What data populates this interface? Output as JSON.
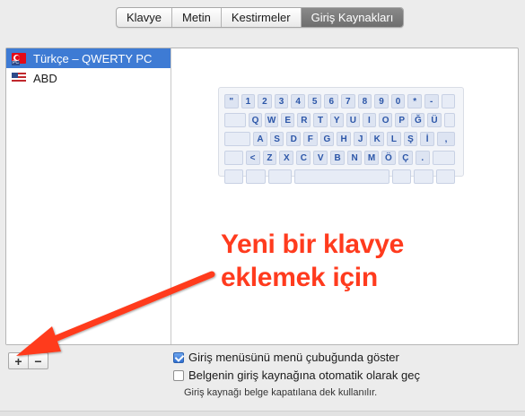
{
  "tabs": [
    {
      "label": "Klavye",
      "active": false
    },
    {
      "label": "Metin",
      "active": false
    },
    {
      "label": "Kestirmeler",
      "active": false
    },
    {
      "label": "Giriş Kaynakları",
      "active": true
    }
  ],
  "sources": [
    {
      "label": "Türkçe – QWERTY PC",
      "icon": "turkish-flag-icon",
      "selected": true
    },
    {
      "label": "ABD",
      "icon": "us-flag-icon",
      "selected": false
    }
  ],
  "keyboard": {
    "rows": [
      [
        "\"",
        "1",
        "2",
        "3",
        "4",
        "5",
        "6",
        "7",
        "8",
        "9",
        "0",
        "*",
        "-",
        ""
      ],
      [
        "",
        "Q",
        "W",
        "E",
        "R",
        "T",
        "Y",
        "U",
        "I",
        "O",
        "P",
        "Ğ",
        "Ü",
        ""
      ],
      [
        "",
        "A",
        "S",
        "D",
        "F",
        "G",
        "H",
        "J",
        "K",
        "L",
        "Ş",
        "İ",
        ","
      ],
      [
        "",
        "<",
        "Z",
        "X",
        "C",
        "V",
        "B",
        "N",
        "M",
        "Ö",
        "Ç",
        ".",
        ""
      ]
    ]
  },
  "list_controls": {
    "add_label": "+",
    "remove_label": "−"
  },
  "options": {
    "show_menu": {
      "label": "Giriş menüsünü menü çubuğunda göster",
      "checked": true
    },
    "auto_switch": {
      "label": "Belgenin giriş kaynağına otomatik olarak geç",
      "checked": false
    },
    "hint": "Giriş kaynağı belge kapatılana dek kullanılır."
  },
  "annotation": {
    "line1": "Yeni bir klavye",
    "line2": "eklemek için",
    "color": "#ff3b1e"
  },
  "colors": {
    "selection": "#3e7bd4",
    "key_text": "#2c56a8"
  }
}
